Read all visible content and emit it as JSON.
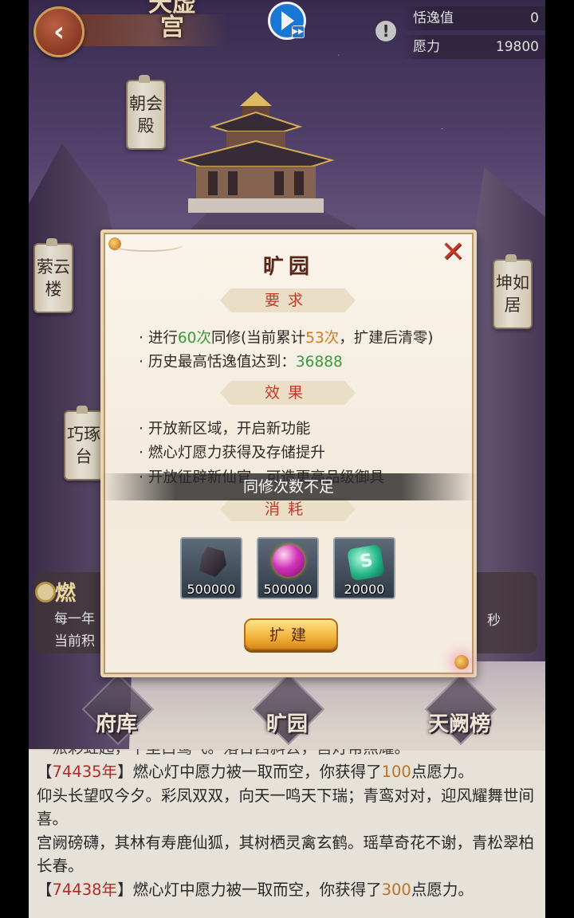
{
  "top": {
    "palace_title": "天虚宫",
    "back_symbol": "‹",
    "play_mini": "▶▶",
    "warn_symbol": "!",
    "stats": [
      {
        "label": "恬逸值",
        "value": "0"
      },
      {
        "label": "愿力",
        "value": "19800"
      }
    ]
  },
  "plaques": {
    "chaohui": "朝会殿",
    "ziyun": "萦云楼",
    "qiaozhuo": "巧琢台",
    "kunru": "坤如居"
  },
  "lamp_panel": {
    "title": "燃",
    "line1": "每一年",
    "line2": "当前积",
    "right": "秒"
  },
  "modal": {
    "title": "旷园",
    "close": "✕",
    "requirements_title": "要求",
    "req1": {
      "pre": "进行",
      "count": "60次",
      "mid": "同修(当前累计",
      "current": "53次",
      "post": "，扩建后清零)"
    },
    "req2": {
      "pre": "历史最高恬逸值达到：",
      "value": "36888"
    },
    "effects_title": "效果",
    "effects": [
      "开放新区域，开启新功能",
      "燃心灯愿力获得及存储提升",
      "开放征辟新仙官，可造更高品级御具"
    ],
    "cost_title": "消耗",
    "items": [
      {
        "icon": "dark-ore-icon",
        "amount": "500000"
      },
      {
        "icon": "magenta-orb-icon",
        "amount": "500000"
      },
      {
        "icon": "jade-stone-icon",
        "amount": "20000"
      }
    ],
    "build_button": "扩建"
  },
  "toast": "同修次数不足",
  "bottom_nav": [
    "府库",
    "旷园",
    "天阙榜"
  ],
  "log": {
    "clipped": "一派彩虹起，千里白鹭飞。落日西斜去，宫灯常照耀。",
    "e1": {
      "open": "【",
      "year": "74435年",
      "close": "】",
      "pre": "燃心灯中愿力被一取而空，你获得了",
      "amount": "100",
      "post": "点愿力。"
    },
    "t1": "仰头长望叹今夕。彩凤双双，向天一鸣天下瑞；青鸾对对，迎风耀舞世间喜。",
    "t2": "宫阙磅礴，其林有寿鹿仙狐，其树栖灵禽玄鹤。瑶草奇花不谢，青松翠柏长春。",
    "e2": {
      "open": "【",
      "year": "74438年",
      "close": "】",
      "pre": "燃心灯中愿力被一取而空，你获得了",
      "amount": "300",
      "post": "点愿力。"
    }
  },
  "colors": {
    "accent_red": "#c0392b",
    "green": "#3b9b3a",
    "orange": "#d97a1c",
    "button_gold": "#f2b23a"
  }
}
